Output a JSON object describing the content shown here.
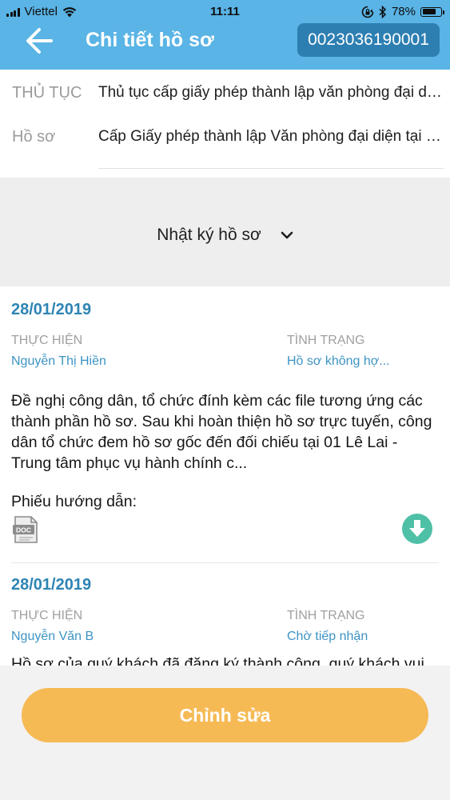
{
  "status_bar": {
    "carrier": "Viettel",
    "time": "11:11",
    "battery": "78%",
    "battery_level": 0.78,
    "icons": [
      "signal-icon",
      "wifi-icon",
      "orientation-lock-icon",
      "bluetooth-icon",
      "battery-icon"
    ]
  },
  "nav": {
    "back_icon": "arrow-left-icon",
    "title": "Chi tiết hồ sơ",
    "record_code": "0023036190001"
  },
  "info": {
    "procedure_label": "THỦ TỤC",
    "procedure_value": "Thủ tục cấp giấy phép thành lập văn phòng đại diện",
    "record_label": "Hồ sơ",
    "record_value": "Cấp Giấy phép thành lập Văn phòng đại diện tại Việt Nam"
  },
  "log": {
    "toggle_label": "Nhật ký hồ sơ",
    "toggle_icon": "chevron-down-icon",
    "entries": [
      {
        "date": "28/01/2019",
        "performer_label": "THỰC HIỆN",
        "performer": "Nguyễn Thị Hiền",
        "status_label": "TÌNH TRẠNG",
        "status": "Hồ sơ không hợ...",
        "description": "Đề nghị công dân, tổ chức đính kèm các file tương ứng các thành phần hồ sơ. Sau khi hoàn thiện hồ sơ trực tuyến, công dân tổ chức đem hồ sơ gốc đến đối chiếu tại 01 Lê Lai - Trung tâm phục vụ hành chính c...",
        "attachment_label": "Phiếu hướng dẫn:",
        "attachment_icon": "doc-file-icon",
        "download_icon": "download-icon"
      },
      {
        "date": "28/01/2019",
        "performer_label": "THỰC HIỆN",
        "performer": "Nguyễn Văn B",
        "status_label": "TÌNH TRẠNG",
        "status": "Chờ tiếp nhận",
        "description": "Hồ sơ của quý khách đã đăng ký thành công, quý khách vui lòng chờ tiếp nhận"
      }
    ]
  },
  "actions": {
    "edit_label": "Chỉnh sửa"
  },
  "colors": {
    "header": "#5ab4e5",
    "badge": "#2d7fb2",
    "date": "#2e84b4",
    "link": "#3d94c4",
    "button": "#f6ba55",
    "download": "#4ec0a6"
  }
}
